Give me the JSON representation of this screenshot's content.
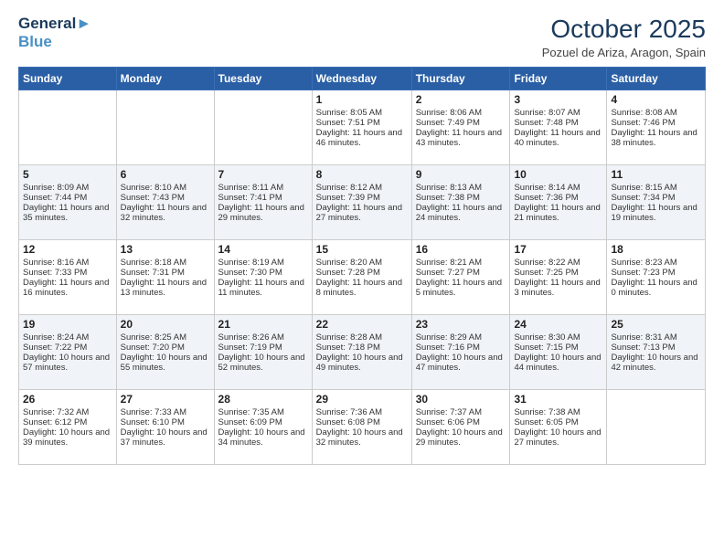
{
  "header": {
    "logo_line1": "General",
    "logo_line2": "Blue",
    "month_title": "October 2025",
    "location": "Pozuel de Ariza, Aragon, Spain"
  },
  "weekdays": [
    "Sunday",
    "Monday",
    "Tuesday",
    "Wednesday",
    "Thursday",
    "Friday",
    "Saturday"
  ],
  "weeks": [
    [
      {
        "day": "",
        "sunrise": "",
        "sunset": "",
        "daylight": ""
      },
      {
        "day": "",
        "sunrise": "",
        "sunset": "",
        "daylight": ""
      },
      {
        "day": "",
        "sunrise": "",
        "sunset": "",
        "daylight": ""
      },
      {
        "day": "1",
        "sunrise": "Sunrise: 8:05 AM",
        "sunset": "Sunset: 7:51 PM",
        "daylight": "Daylight: 11 hours and 46 minutes."
      },
      {
        "day": "2",
        "sunrise": "Sunrise: 8:06 AM",
        "sunset": "Sunset: 7:49 PM",
        "daylight": "Daylight: 11 hours and 43 minutes."
      },
      {
        "day": "3",
        "sunrise": "Sunrise: 8:07 AM",
        "sunset": "Sunset: 7:48 PM",
        "daylight": "Daylight: 11 hours and 40 minutes."
      },
      {
        "day": "4",
        "sunrise": "Sunrise: 8:08 AM",
        "sunset": "Sunset: 7:46 PM",
        "daylight": "Daylight: 11 hours and 38 minutes."
      }
    ],
    [
      {
        "day": "5",
        "sunrise": "Sunrise: 8:09 AM",
        "sunset": "Sunset: 7:44 PM",
        "daylight": "Daylight: 11 hours and 35 minutes."
      },
      {
        "day": "6",
        "sunrise": "Sunrise: 8:10 AM",
        "sunset": "Sunset: 7:43 PM",
        "daylight": "Daylight: 11 hours and 32 minutes."
      },
      {
        "day": "7",
        "sunrise": "Sunrise: 8:11 AM",
        "sunset": "Sunset: 7:41 PM",
        "daylight": "Daylight: 11 hours and 29 minutes."
      },
      {
        "day": "8",
        "sunrise": "Sunrise: 8:12 AM",
        "sunset": "Sunset: 7:39 PM",
        "daylight": "Daylight: 11 hours and 27 minutes."
      },
      {
        "day": "9",
        "sunrise": "Sunrise: 8:13 AM",
        "sunset": "Sunset: 7:38 PM",
        "daylight": "Daylight: 11 hours and 24 minutes."
      },
      {
        "day": "10",
        "sunrise": "Sunrise: 8:14 AM",
        "sunset": "Sunset: 7:36 PM",
        "daylight": "Daylight: 11 hours and 21 minutes."
      },
      {
        "day": "11",
        "sunrise": "Sunrise: 8:15 AM",
        "sunset": "Sunset: 7:34 PM",
        "daylight": "Daylight: 11 hours and 19 minutes."
      }
    ],
    [
      {
        "day": "12",
        "sunrise": "Sunrise: 8:16 AM",
        "sunset": "Sunset: 7:33 PM",
        "daylight": "Daylight: 11 hours and 16 minutes."
      },
      {
        "day": "13",
        "sunrise": "Sunrise: 8:18 AM",
        "sunset": "Sunset: 7:31 PM",
        "daylight": "Daylight: 11 hours and 13 minutes."
      },
      {
        "day": "14",
        "sunrise": "Sunrise: 8:19 AM",
        "sunset": "Sunset: 7:30 PM",
        "daylight": "Daylight: 11 hours and 11 minutes."
      },
      {
        "day": "15",
        "sunrise": "Sunrise: 8:20 AM",
        "sunset": "Sunset: 7:28 PM",
        "daylight": "Daylight: 11 hours and 8 minutes."
      },
      {
        "day": "16",
        "sunrise": "Sunrise: 8:21 AM",
        "sunset": "Sunset: 7:27 PM",
        "daylight": "Daylight: 11 hours and 5 minutes."
      },
      {
        "day": "17",
        "sunrise": "Sunrise: 8:22 AM",
        "sunset": "Sunset: 7:25 PM",
        "daylight": "Daylight: 11 hours and 3 minutes."
      },
      {
        "day": "18",
        "sunrise": "Sunrise: 8:23 AM",
        "sunset": "Sunset: 7:23 PM",
        "daylight": "Daylight: 11 hours and 0 minutes."
      }
    ],
    [
      {
        "day": "19",
        "sunrise": "Sunrise: 8:24 AM",
        "sunset": "Sunset: 7:22 PM",
        "daylight": "Daylight: 10 hours and 57 minutes."
      },
      {
        "day": "20",
        "sunrise": "Sunrise: 8:25 AM",
        "sunset": "Sunset: 7:20 PM",
        "daylight": "Daylight: 10 hours and 55 minutes."
      },
      {
        "day": "21",
        "sunrise": "Sunrise: 8:26 AM",
        "sunset": "Sunset: 7:19 PM",
        "daylight": "Daylight: 10 hours and 52 minutes."
      },
      {
        "day": "22",
        "sunrise": "Sunrise: 8:28 AM",
        "sunset": "Sunset: 7:18 PM",
        "daylight": "Daylight: 10 hours and 49 minutes."
      },
      {
        "day": "23",
        "sunrise": "Sunrise: 8:29 AM",
        "sunset": "Sunset: 7:16 PM",
        "daylight": "Daylight: 10 hours and 47 minutes."
      },
      {
        "day": "24",
        "sunrise": "Sunrise: 8:30 AM",
        "sunset": "Sunset: 7:15 PM",
        "daylight": "Daylight: 10 hours and 44 minutes."
      },
      {
        "day": "25",
        "sunrise": "Sunrise: 8:31 AM",
        "sunset": "Sunset: 7:13 PM",
        "daylight": "Daylight: 10 hours and 42 minutes."
      }
    ],
    [
      {
        "day": "26",
        "sunrise": "Sunrise: 7:32 AM",
        "sunset": "Sunset: 6:12 PM",
        "daylight": "Daylight: 10 hours and 39 minutes."
      },
      {
        "day": "27",
        "sunrise": "Sunrise: 7:33 AM",
        "sunset": "Sunset: 6:10 PM",
        "daylight": "Daylight: 10 hours and 37 minutes."
      },
      {
        "day": "28",
        "sunrise": "Sunrise: 7:35 AM",
        "sunset": "Sunset: 6:09 PM",
        "daylight": "Daylight: 10 hours and 34 minutes."
      },
      {
        "day": "29",
        "sunrise": "Sunrise: 7:36 AM",
        "sunset": "Sunset: 6:08 PM",
        "daylight": "Daylight: 10 hours and 32 minutes."
      },
      {
        "day": "30",
        "sunrise": "Sunrise: 7:37 AM",
        "sunset": "Sunset: 6:06 PM",
        "daylight": "Daylight: 10 hours and 29 minutes."
      },
      {
        "day": "31",
        "sunrise": "Sunrise: 7:38 AM",
        "sunset": "Sunset: 6:05 PM",
        "daylight": "Daylight: 10 hours and 27 minutes."
      },
      {
        "day": "",
        "sunrise": "",
        "sunset": "",
        "daylight": ""
      }
    ]
  ]
}
